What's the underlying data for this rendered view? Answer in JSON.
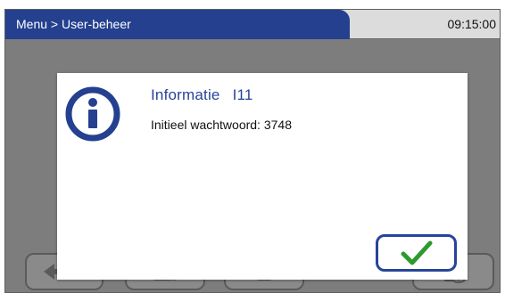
{
  "header": {
    "breadcrumb": "Menu > User-beheer",
    "time": "09:15:00"
  },
  "dialog": {
    "title": "Informatie",
    "code": "I11",
    "message_label": "Initieel wachtwoord:",
    "message_value": "3748",
    "icon": "info-icon",
    "ok_icon": "checkmark-icon"
  },
  "toolbar": {
    "icons": [
      "back-arrow-icon",
      "add-user-icon",
      "delete-icon",
      "view-document-icon"
    ]
  },
  "colors": {
    "brand_blue": "#24408f",
    "ok_green": "#2e9a2e",
    "overlay_gray": "#7d7d7d"
  }
}
